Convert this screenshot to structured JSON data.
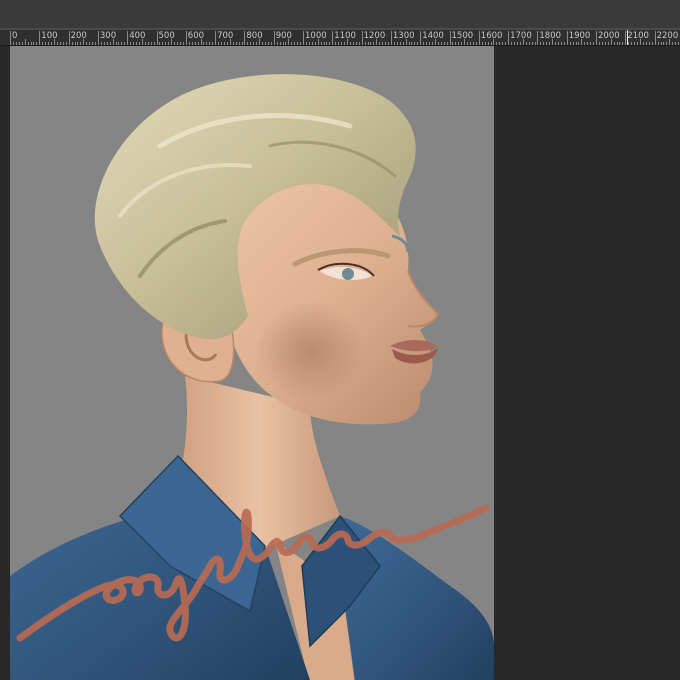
{
  "ruler": {
    "units": "px",
    "labels": [
      "0",
      "100",
      "200",
      "300",
      "400",
      "500",
      "600",
      "700",
      "800",
      "900",
      "1000",
      "1100",
      "1200",
      "1300",
      "1400",
      "1500",
      "1600",
      "1700",
      "1800",
      "1900",
      "2000",
      "2100",
      "2200"
    ]
  },
  "canvas": {
    "background": "#858585",
    "workspace": "#282828",
    "signature_text": "origentum",
    "signature_color": "#b86a52"
  },
  "artwork": {
    "hair_color": "#c9c09a",
    "skin_color": "#e2b595",
    "shirt_color": "#33587f",
    "eye_color": "#6f8c92"
  }
}
